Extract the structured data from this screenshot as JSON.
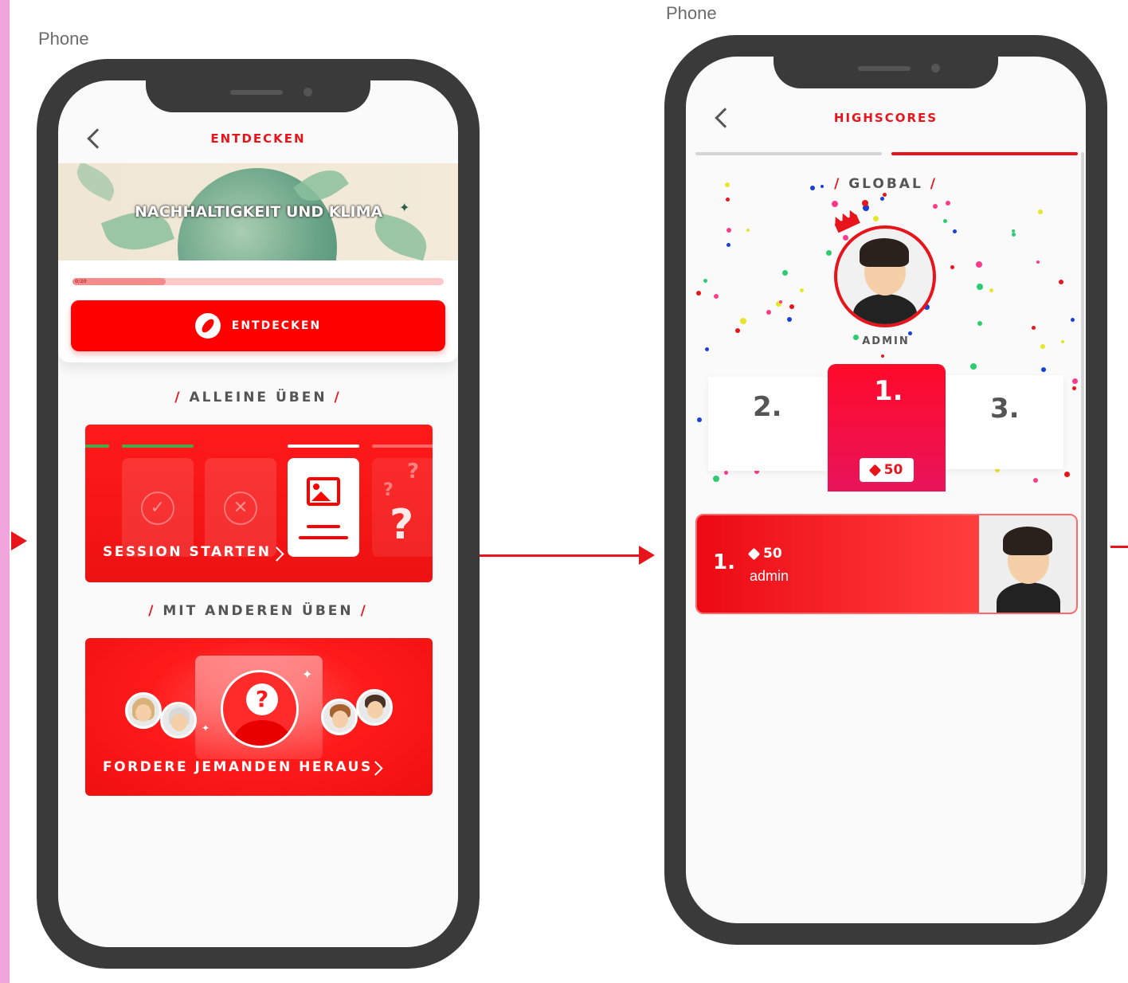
{
  "frames": [
    {
      "label": "Phone"
    },
    {
      "label": "Phone"
    }
  ],
  "screen1": {
    "nav_title": "ENTDECKEN",
    "banner_title": "NACHHALTIGKEIT UND KLIMA",
    "progress": 0.25,
    "progress_label": "0/20",
    "discover_button": "ENTDECKEN",
    "section_alone": "ALLEINE ÜBEN",
    "section_others": "MIT ANDEREN ÜBEN",
    "session_label": "SESSION STARTEN",
    "challenge_label": "FORDERE JEMANDEN HERAUS"
  },
  "screen2": {
    "nav_title": "HIGHSCORES",
    "scope_label": "GLOBAL",
    "winner_name": "ADMIN",
    "podium": {
      "first": "1.",
      "second": "2.",
      "third": "3.",
      "first_score": "50"
    },
    "rows": [
      {
        "rank": "1.",
        "score": "50",
        "name": "admin"
      }
    ]
  },
  "colors": {
    "accent": "#e8141c",
    "bright_red": "#ff0000",
    "phone_bezel": "#3a3a3a",
    "screen_bg": "#fafafa"
  }
}
